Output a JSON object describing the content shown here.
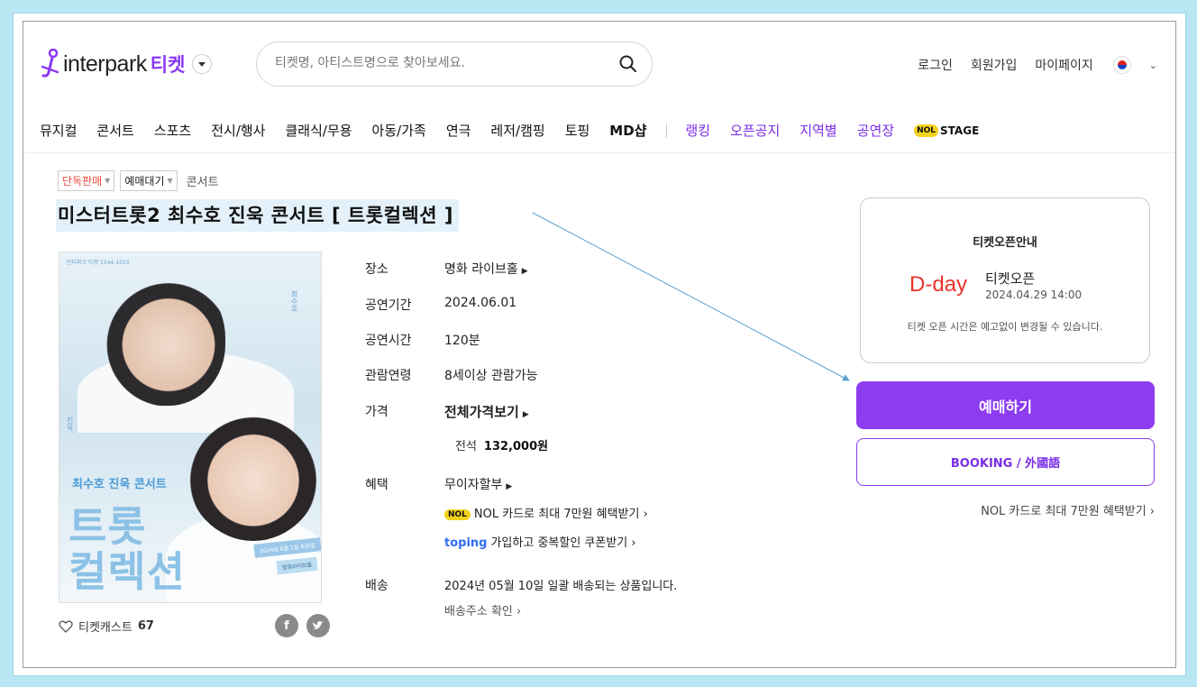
{
  "header": {
    "logo_text": "interpark",
    "logo_ticket": "티켓",
    "search_placeholder": "티켓명, 아티스트명으로 찾아보세요.",
    "links": [
      "로그인",
      "회원가입",
      "마이페이지"
    ]
  },
  "nav": {
    "items": [
      "뮤지컬",
      "콘서트",
      "스포츠",
      "전시/행사",
      "클래식/무용",
      "아동/가족",
      "연극",
      "레저/캠핑",
      "토핑",
      "MD샵"
    ],
    "highlight_items": [
      "랭킹",
      "오픈공지",
      "지역별",
      "공연장"
    ],
    "stage_badge": "NOL",
    "stage_text": "STAGE"
  },
  "product": {
    "tags": [
      "단독판매",
      "예매대기"
    ],
    "breadcrumb": "콘서트",
    "title": "미스터트롯2 최수호 진욱 콘서트 [ 트롯컬렉션 ]",
    "poster": {
      "header": "인터파크 티켓 1544-1555",
      "name1": "최수호",
      "name2": "진욱",
      "subtitle": "최수호 진욱 콘서트",
      "big1": "트롯",
      "big2": "컬렉션",
      "date_ribbon": "2024년 6월 1일 토요일",
      "venue_ribbon": "명화라이브홀"
    },
    "cast_label": "티켓캐스트",
    "cast_count": "67"
  },
  "info": {
    "venue_label": "장소",
    "venue": "명화 라이브홀",
    "period_label": "공연기간",
    "period": "2024.06.01",
    "runtime_label": "공연시간",
    "runtime": "120분",
    "age_label": "관람연령",
    "age": "8세이상 관람가능",
    "price_label": "가격",
    "price_all": "전체가격보기",
    "seat_label": "전석",
    "seat_price": "132,000원",
    "benefit_label": "혜택",
    "benefit1": "무이자할부",
    "nol_badge": "NOL",
    "benefit2": "NOL 카드로 최대 7만원 혜택받기",
    "toping_badge": "toping",
    "benefit3": "가입하고 중복할인 쿠폰받기",
    "delivery_label": "배송",
    "delivery": "2024년 05월 10일 일괄 배송되는 상품입니다.",
    "delivery_check": "배송주소 확인"
  },
  "ticket_open": {
    "title": "티켓오픈안내",
    "dday": "D-day",
    "label": "티켓오픈",
    "date": "2024.04.29 14:00",
    "note": "티켓 오픈 시간은 예고없이 변경될 수 있습니다."
  },
  "actions": {
    "book": "예매하기",
    "book_en": "BOOKING / 外國語",
    "nol_link": "NOL 카드로 최대 7만원 혜택받기"
  },
  "colors": {
    "brand_purple": "#8d3cf0",
    "dday_red": "#e8342b",
    "annotation_line": "#5a9fd0"
  }
}
